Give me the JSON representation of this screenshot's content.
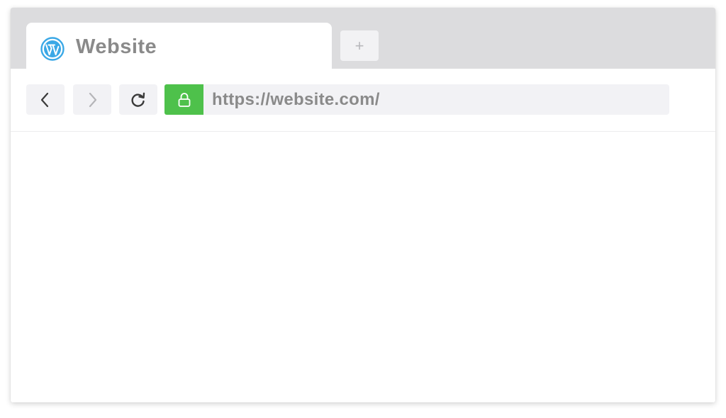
{
  "tab": {
    "title": "Website",
    "icon": "wordpress-icon"
  },
  "new_tab": {
    "label": "+"
  },
  "toolbar": {
    "back_icon": "chevron-left-icon",
    "forward_icon": "chevron-right-icon",
    "reload_icon": "reload-icon",
    "lock_icon": "lock-icon"
  },
  "address_bar": {
    "url": "https://website.com/"
  },
  "colors": {
    "tabbar_bg": "#dcdcde",
    "secure_green": "#4ec14b",
    "wordpress_blue": "#3aa8e6",
    "text_gray": "#8a8a8a"
  }
}
